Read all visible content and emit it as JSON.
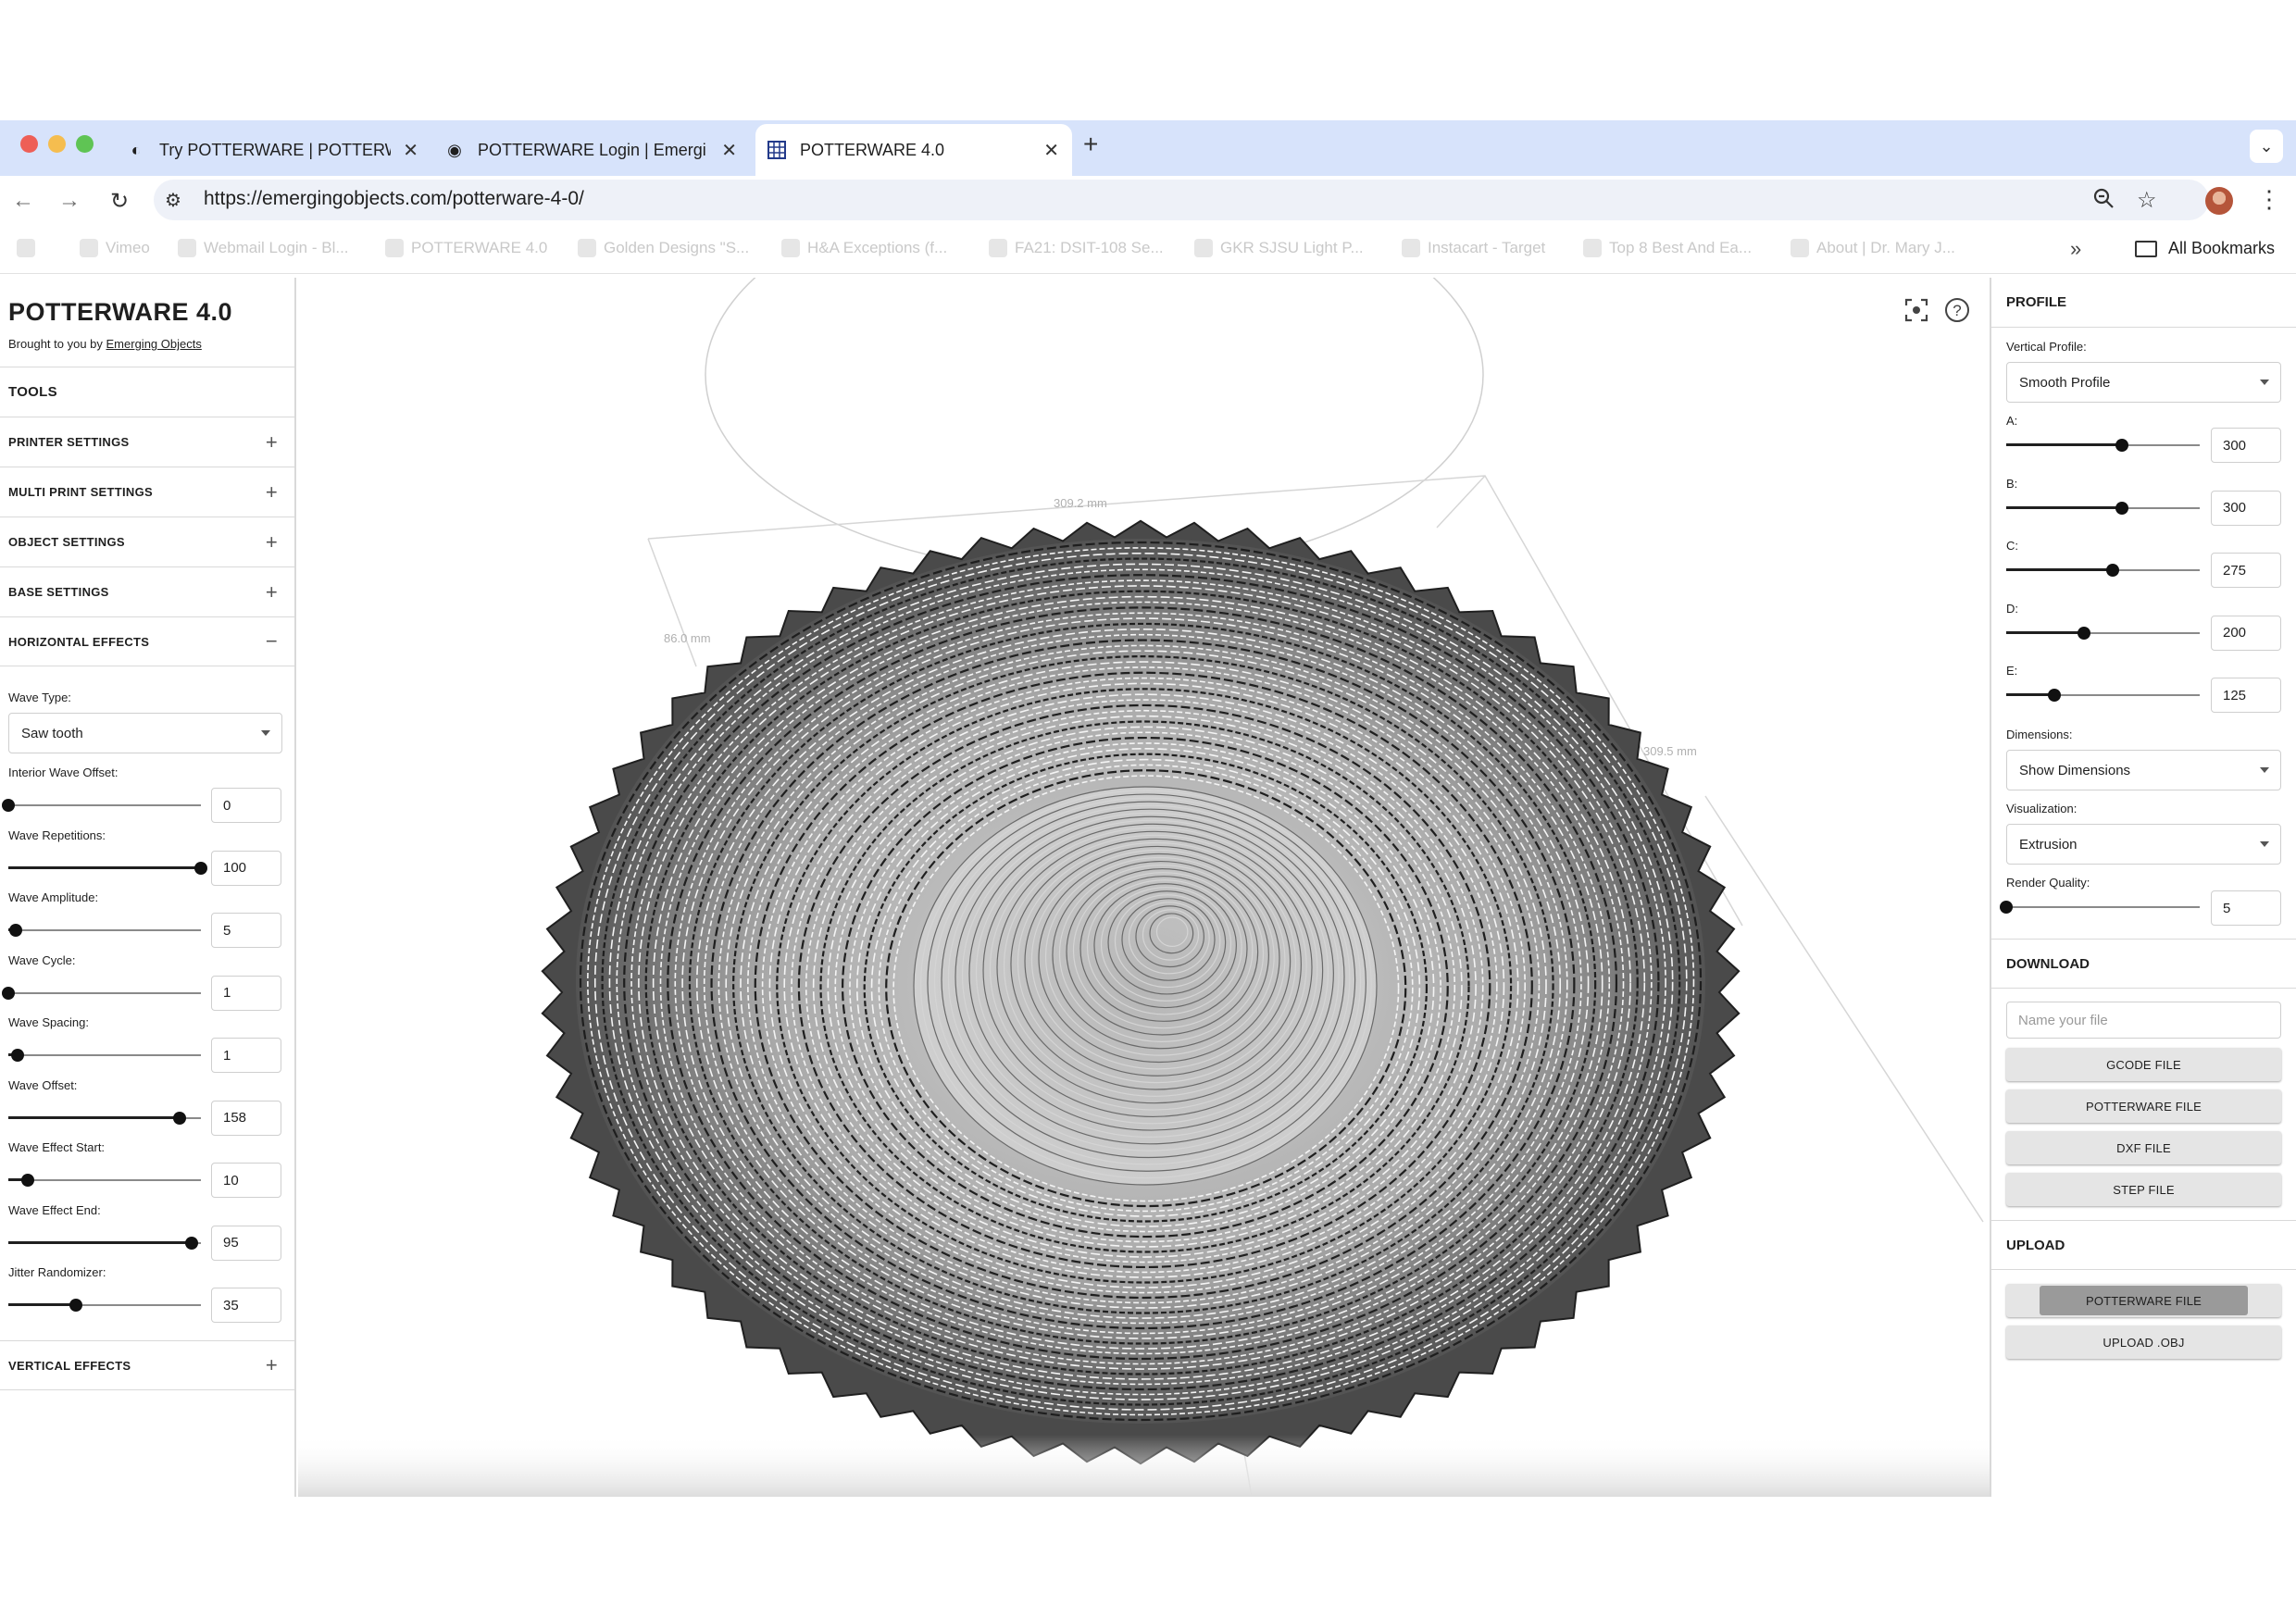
{
  "browser": {
    "tabs": [
      {
        "title": "Try POTTERWARE | POTTERW",
        "icon": "half-moon-icon"
      },
      {
        "title": "POTTERWARE Login | Emergi",
        "icon": "eo-logo-icon"
      },
      {
        "title": "POTTERWARE 4.0",
        "icon": "grid-icon"
      }
    ],
    "url": "https://emergingobjects.com/potterware-4-0/",
    "bookmarks": [
      "Vimeo",
      "Webmail Login - Bl...",
      "POTTERWARE 4.0",
      "Golden Designs \"S...",
      "H&A Exceptions (f...",
      "FA21: DSIT-108 Se...",
      "GKR SJSU Light P...",
      "Instacart - Target",
      "Top 8 Best And Ea...",
      "About | Dr. Mary J..."
    ],
    "all_bookmarks": "All Bookmarks"
  },
  "app": {
    "title": "POTTERWARE 4.0",
    "brought_prefix": "Brought to you by ",
    "brought_link": "Emerging Objects"
  },
  "left": {
    "tools": "TOOLS",
    "sections": {
      "printer": "PRINTER SETTINGS",
      "multi": "MULTI PRINT SETTINGS",
      "object": "OBJECT SETTINGS",
      "base": "BASE SETTINGS",
      "horizontal": "HORIZONTAL EFFECTS",
      "vertical": "VERTICAL EFFECTS"
    },
    "wave_type_label": "Wave Type:",
    "wave_type_value": "Saw tooth",
    "params": [
      {
        "label": "Interior Wave Offset:",
        "value": "0",
        "fraction": 0.0
      },
      {
        "label": "Wave Repetitions:",
        "value": "100",
        "fraction": 1.0
      },
      {
        "label": "Wave Amplitude:",
        "value": "5",
        "fraction": 0.04
      },
      {
        "label": "Wave Cycle:",
        "value": "1",
        "fraction": 0.0
      },
      {
        "label": "Wave Spacing:",
        "value": "1",
        "fraction": 0.05
      },
      {
        "label": "Wave Offset:",
        "value": "158",
        "fraction": 0.89
      },
      {
        "label": "Wave Effect Start:",
        "value": "10",
        "fraction": 0.1
      },
      {
        "label": "Wave Effect End:",
        "value": "95",
        "fraction": 0.95
      },
      {
        "label": "Jitter Randomizer:",
        "value": "35",
        "fraction": 0.35
      }
    ]
  },
  "right": {
    "profile": "PROFILE",
    "vertical_profile_label": "Vertical Profile:",
    "vertical_profile_value": "Smooth Profile",
    "profile_params": [
      {
        "label": "A:",
        "value": "300",
        "fraction": 0.6
      },
      {
        "label": "B:",
        "value": "300",
        "fraction": 0.6
      },
      {
        "label": "C:",
        "value": "275",
        "fraction": 0.55
      },
      {
        "label": "D:",
        "value": "200",
        "fraction": 0.4
      },
      {
        "label": "E:",
        "value": "125",
        "fraction": 0.25
      }
    ],
    "dimensions_label": "Dimensions:",
    "dimensions_value": "Show Dimensions",
    "visualization_label": "Visualization:",
    "visualization_value": "Extrusion",
    "render_quality_label": "Render Quality:",
    "render_quality_value": "5",
    "render_quality_fraction": 0.0,
    "download": "DOWNLOAD",
    "filename_placeholder": "Name your file",
    "buttons": [
      "GCODE FILE",
      "POTTERWARE FILE",
      "DXF FILE",
      "STEP FILE"
    ],
    "upload": "UPLOAD",
    "upload_buttons": [
      "POTTERWARE FILE",
      "UPLOAD .OBJ"
    ]
  },
  "viewport": {
    "dims": [
      "309.2 mm",
      "86.0 mm",
      "309.5 mm"
    ]
  }
}
